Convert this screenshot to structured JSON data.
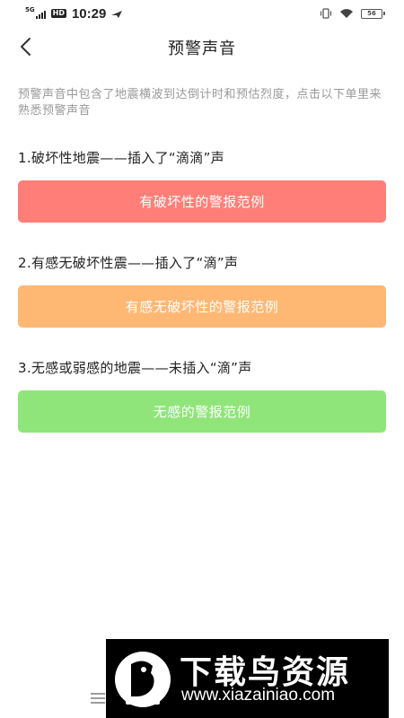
{
  "status_bar": {
    "network": "5G",
    "hd": "HD",
    "time": "10:29",
    "battery_level": "56"
  },
  "header": {
    "title": "预警声音"
  },
  "description": "预警声音中包含了地震横波到达倒计时和预估烈度，点击以下单里来熟悉预警声音",
  "sections": [
    {
      "heading": "1.破坏性地震——插入了“滴滴”声",
      "button_label": "有破坏性的警报范例",
      "color": "#ff7f78"
    },
    {
      "heading": "2.有感无破坏性震——插入了“滴”声",
      "button_label": "有感无破坏性的警报范例",
      "color": "#ffb874"
    },
    {
      "heading": "3.无感或弱感的地震——未插入“滴”声",
      "button_label": "无感的警报范例",
      "color": "#90e57a"
    }
  ],
  "watermark": {
    "title": "下载鸟资源",
    "url": "www.xiazainiao.com"
  }
}
